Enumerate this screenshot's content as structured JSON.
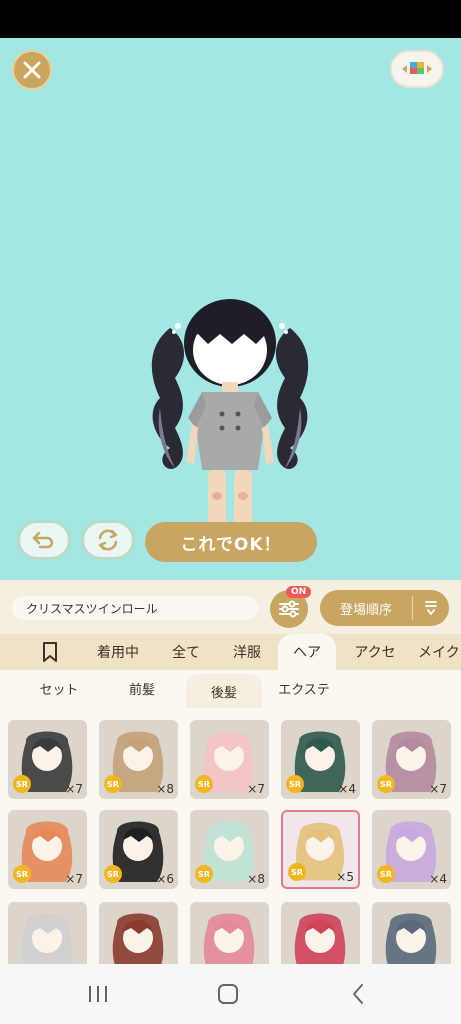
{
  "stage": {
    "ok_button_label": "これでOK！",
    "bg_color": "#a4e6e3",
    "accent_color": "#c8a560"
  },
  "controls": {
    "item_name": "クリスマスツインロール",
    "filter_badge": "ON",
    "sort_label": "登場順序"
  },
  "tabs": [
    {
      "label": "",
      "icon": "bookmark-icon"
    },
    {
      "label": "着用中"
    },
    {
      "label": "全て"
    },
    {
      "label": "洋服"
    },
    {
      "label": "ヘア",
      "active": true
    },
    {
      "label": "アクセ"
    },
    {
      "label": "メイク"
    }
  ],
  "subtabs": [
    {
      "label": "セット"
    },
    {
      "label": "前髪"
    },
    {
      "label": "後髪",
      "active": true
    },
    {
      "label": "エクステ"
    }
  ],
  "items": [
    {
      "rarity": "SR",
      "count": "×7",
      "hair": "#3b3b3b"
    },
    {
      "rarity": "SR",
      "count": "×8",
      "hair": "#c4a27a"
    },
    {
      "rarity": "SR",
      "count": "×7",
      "hair": "#f4c4c9"
    },
    {
      "rarity": "SR",
      "count": "×4",
      "hair": "#2f5a4c"
    },
    {
      "rarity": "SR",
      "count": "×7",
      "hair": "#b58aa0"
    },
    {
      "rarity": "SR",
      "count": "×7",
      "hair": "#e58a5a"
    },
    {
      "rarity": "SR",
      "count": "×6",
      "hair": "#1f1f1f"
    },
    {
      "rarity": "SR",
      "count": "×8",
      "hair": "#bfe3d5"
    },
    {
      "rarity": "SR",
      "count": "×5",
      "hair": "#e2c27a",
      "selected": true
    },
    {
      "rarity": "SR",
      "count": "×4",
      "hair": "#c8a8de"
    },
    {
      "rarity": "",
      "count": "",
      "hair": "#d0d0d0"
    },
    {
      "rarity": "",
      "count": "",
      "hair": "#8a3b2e"
    },
    {
      "rarity": "",
      "count": "",
      "hair": "#e48a9a"
    },
    {
      "rarity": "",
      "count": "",
      "hair": "#d0445a"
    },
    {
      "rarity": "",
      "count": "",
      "hair": "#5a6a7a"
    }
  ]
}
